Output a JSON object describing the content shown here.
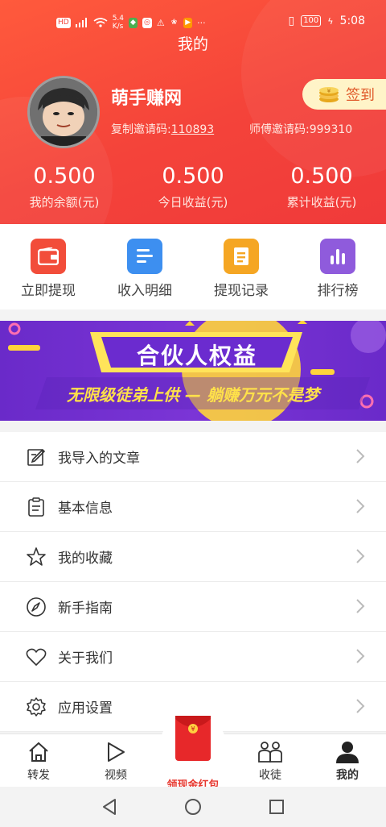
{
  "status": {
    "net_speed": "5.4\nK/s",
    "battery": "100",
    "time": "5:08"
  },
  "header": {
    "title": "我的",
    "nickname": "萌手赚网",
    "signin_label": "签到",
    "copy_code_label": "复制邀请码:",
    "copy_code_value": "110893",
    "master_code_label": "师傅邀请码:",
    "master_code_value": "999310"
  },
  "stats": [
    {
      "value": "0.500",
      "label": "我的余额(元)"
    },
    {
      "value": "0.500",
      "label": "今日收益(元)"
    },
    {
      "value": "0.500",
      "label": "累计收益(元)"
    }
  ],
  "actions": [
    {
      "label": "立即提现",
      "icon": "wallet-icon",
      "color": "#f24d3a"
    },
    {
      "label": "收入明细",
      "icon": "list-icon",
      "color": "#3d8ff0"
    },
    {
      "label": "提现记录",
      "icon": "record-icon",
      "color": "#f5a623"
    },
    {
      "label": "排行榜",
      "icon": "chart-icon",
      "color": "#8f5bdc"
    }
  ],
  "banner": {
    "title": "合伙人权益",
    "subtitle": "无限级徒弟上供 — 躺赚万元不是梦"
  },
  "menu": [
    {
      "label": "我导入的文章",
      "icon": "edit-icon"
    },
    {
      "label": "基本信息",
      "icon": "clipboard-icon"
    },
    {
      "label": "我的收藏",
      "icon": "star-icon"
    },
    {
      "label": "新手指南",
      "icon": "compass-icon"
    },
    {
      "label": "关于我们",
      "icon": "heart-icon"
    },
    {
      "label": "应用设置",
      "icon": "gear-icon"
    }
  ],
  "tabs": [
    {
      "label": "转发",
      "icon": "home-icon"
    },
    {
      "label": "视频",
      "icon": "play-icon"
    },
    {
      "label": "领现金红包",
      "icon": "red-packet-icon"
    },
    {
      "label": "收徒",
      "icon": "apprentice-icon"
    },
    {
      "label": "我的",
      "icon": "user-icon",
      "active": true
    }
  ],
  "colors": {
    "brand_red": "#f4433a",
    "signin_bg": "#fff4c8",
    "banner_purple": "#6a2ac9",
    "banner_yellow": "#ffd43b"
  }
}
